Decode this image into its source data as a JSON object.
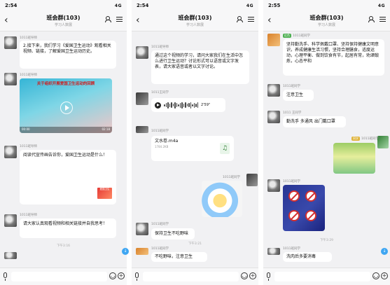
{
  "screens": [
    {
      "time": "2:54",
      "signal": "4G",
      "title": "班会群(103)",
      "subtitle": "学习人数展",
      "messages": [
        {
          "sender": "1011班导师",
          "text": "2.接下来，我们学习《爱国卫生运动》观看相关视频、链接，了解爱国卫生运动历史。"
        },
        {
          "sender": "1011班导师",
          "video_title": "关于组织开展爱国卫生运动的回顾",
          "video_time": "00:00",
          "video_duration": "02:18"
        },
        {
          "sender": "1011班导师",
          "text": "阅读代宣传画告诉你，爱国卫生运动是什么！",
          "poster_text": "爱国卫生"
        },
        {
          "sender": "1011班导师",
          "text": "请大家认真观看视频和相关链接并自我思考！"
        }
      ],
      "timestamp": "下午3:16"
    },
    {
      "time": "2:54",
      "signal": "4G",
      "title": "班会群(103)",
      "subtitle": "学习人数展",
      "messages": [
        {
          "sender": "1011班导师",
          "text": "通过这个视频的学习，请问大家我们在生活中怎么进行卫生运动？讨论形式可以语音或文字发表，请大家语音或者以文字讨论。"
        },
        {
          "sender": "1011王同学",
          "voice_duration": "2'59\""
        },
        {
          "sender": "1011班同学",
          "file_name": "文水卷.m4a",
          "file_size": "1784.2KB"
        },
        {
          "sender": "1011班同学",
          "sticker": true
        },
        {
          "sender": "1011班同学",
          "text": "保持卫生不吃野味"
        },
        {
          "sender": "1011班同学",
          "text": "不吃野味，注意卫生"
        }
      ],
      "timestamp": "下午3:21"
    },
    {
      "time": "2:55",
      "signal": "4G",
      "title": "班会群(103)",
      "subtitle": "学习人数展",
      "messages": [
        {
          "sender": "1011班同学",
          "tag": "红色",
          "text": "坚持勤洗手、科学佩戴口罩、坚持保持健康文明意识，养成健康生活习惯，坚持合理膳食，适度运动，心理平衡、做到饮食有节，起居有常，劝酒锻炼，心态平和"
        },
        {
          "sender": "1011班同学",
          "text": "注意卫生"
        },
        {
          "sender": "1011 王同学",
          "text": "勤洗手 多通风 出门戴口罩"
        },
        {
          "sender": "1011班同学",
          "tag": "同学",
          "image": "exercise-photo"
        },
        {
          "sender": "1011班同学",
          "image": "no-wildlife-poster"
        },
        {
          "sender": "1011班同学",
          "text": "洗肉后多要消毒"
        }
      ],
      "timestamp": "下午3:29"
    }
  ],
  "input": {
    "placeholder": ""
  },
  "colors": {
    "screen_bg": "#f1f1f3",
    "bubble": "#ffffff",
    "accent_blue": "#3ea6f2",
    "tag_green": "#4caf50"
  }
}
